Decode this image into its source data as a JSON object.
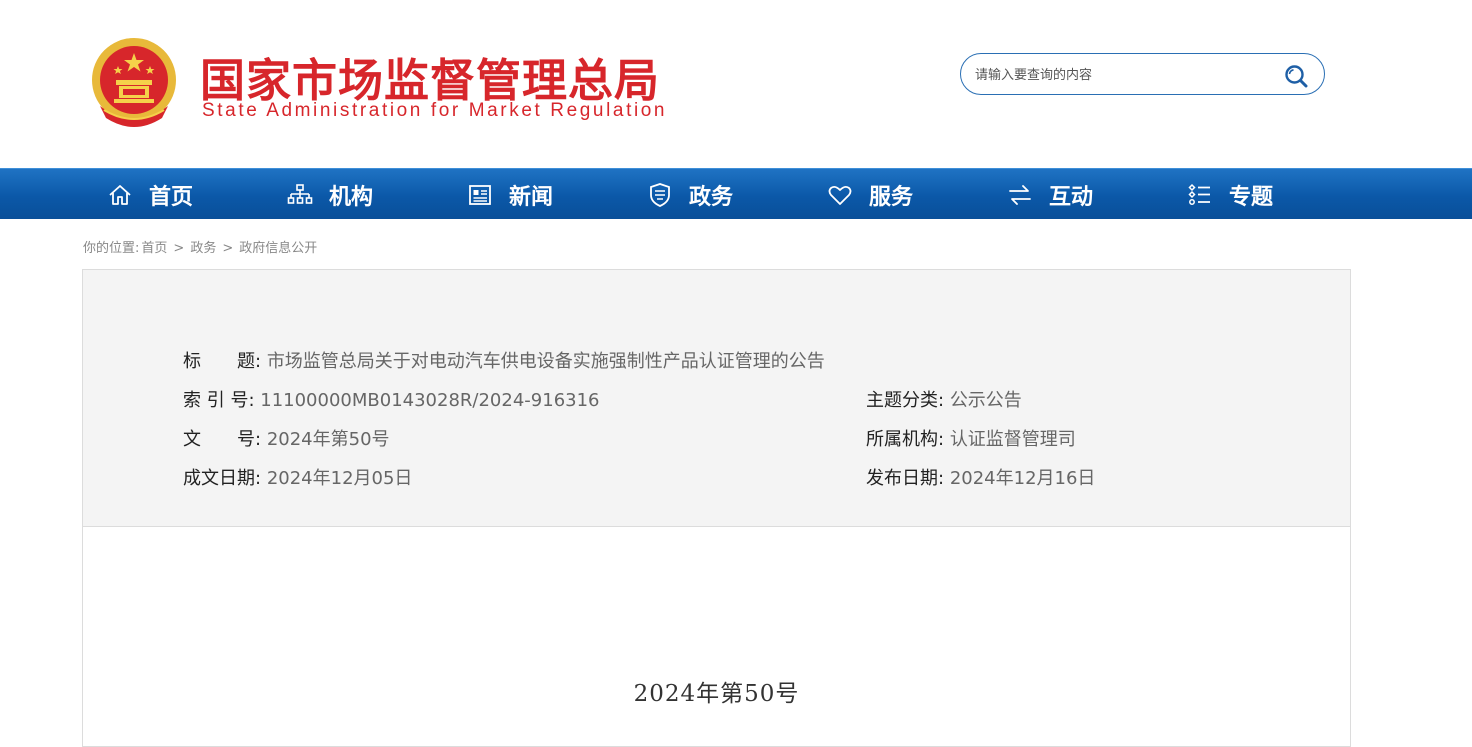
{
  "header": {
    "title_cn": "国家市场监督管理总局",
    "title_en": "State Administration for Market Regulation",
    "emblem_icon": "national-emblem-icon"
  },
  "search": {
    "placeholder": "请输入要查询的内容",
    "button_icon": "search-icon"
  },
  "nav": {
    "items": [
      {
        "label": "首页",
        "icon": "home-icon"
      },
      {
        "label": "机构",
        "icon": "org-chart-icon"
      },
      {
        "label": "新闻",
        "icon": "newspaper-icon"
      },
      {
        "label": "政务",
        "icon": "government-shield-icon"
      },
      {
        "label": "服务",
        "icon": "heart-icon"
      },
      {
        "label": "互动",
        "icon": "exchange-arrows-icon"
      },
      {
        "label": "专题",
        "icon": "topics-list-icon"
      }
    ]
  },
  "breadcrumb": {
    "prefix": "你的位置:",
    "items": [
      "首页",
      "政务",
      "政府信息公开"
    ],
    "separator": ">"
  },
  "info": {
    "title_label": "标　　题:",
    "title_value": "市场监管总局关于对电动汽车供电设备实施强制性产品认证管理的公告",
    "index_label": "索 引 号:",
    "index_value": "11100000MB0143028R/2024-916316",
    "category_label": "主题分类:",
    "category_value": "公示公告",
    "docno_label": "文　　号:",
    "docno_value": "2024年第50号",
    "org_label": "所属机构:",
    "org_value": "认证监督管理司",
    "created_label": "成文日期:",
    "created_value": "2024年12月05日",
    "published_label": "发布日期:",
    "published_value": "2024年12月16日"
  },
  "document": {
    "number": "2024年第50号"
  },
  "colors": {
    "brand_red": "#d7262b",
    "nav_blue": "#0b58a8",
    "search_border": "#2a6fb4"
  }
}
